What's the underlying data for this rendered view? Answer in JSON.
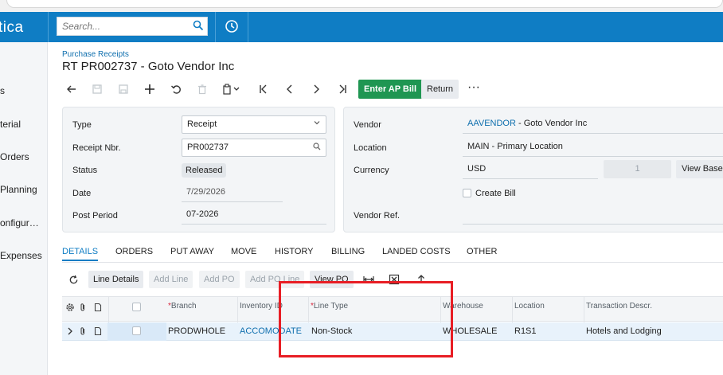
{
  "app": {
    "logo_text": "tica"
  },
  "search": {
    "placeholder": "Search..."
  },
  "sidebar": {
    "items": [
      {
        "label": "s"
      },
      {
        "label": "terial"
      },
      {
        "label": " Orders"
      },
      {
        "label": "Planning"
      },
      {
        "label": "onfigur…"
      },
      {
        "label": "Expenses"
      }
    ]
  },
  "page": {
    "breadcrumb": "Purchase Receipts",
    "title": "RT PR002737 - Goto Vendor Inc"
  },
  "toolbar": {
    "enter_ap_bill": "Enter AP Bill",
    "return": "Return",
    "more": "···"
  },
  "summary": {
    "type_label": "Type",
    "type_value": "Receipt",
    "receipt_nbr_label": "Receipt Nbr.",
    "receipt_nbr_value": "PR002737",
    "status_label": "Status",
    "status_value": "Released",
    "date_label": "Date",
    "date_value": "7/29/2026",
    "post_period_label": "Post Period",
    "post_period_value": "07-2026",
    "vendor_label": "Vendor",
    "vendor_code": "AAVENDOR",
    "vendor_name": " - Goto Vendor Inc",
    "location_label": "Location",
    "location_value": "MAIN - Primary Location",
    "currency_label": "Currency",
    "currency_value": "USD",
    "currency_rate": "1",
    "view_base": "View Base",
    "create_bill_label": "Create Bill",
    "vendor_ref_label": "Vendor Ref."
  },
  "tabs": [
    {
      "label": "DETAILS",
      "active": true
    },
    {
      "label": "ORDERS"
    },
    {
      "label": "PUT AWAY"
    },
    {
      "label": "MOVE"
    },
    {
      "label": "HISTORY"
    },
    {
      "label": "BILLING"
    },
    {
      "label": "LANDED COSTS"
    },
    {
      "label": "OTHER"
    }
  ],
  "grid_toolbar": {
    "line_details": "Line Details",
    "add_line": "Add Line",
    "add_po": "Add PO",
    "add_po_line": "Add PO Line",
    "view_po": "View PO"
  },
  "grid": {
    "columns": {
      "branch": "Branch",
      "inventory_id": "Inventory ID",
      "line_type": "Line Type",
      "warehouse": "Warehouse",
      "location": "Location",
      "transaction_descr": "Transaction Descr."
    },
    "rows": [
      {
        "branch": "PRODWHOLE",
        "inventory_id": "ACCOMODATE",
        "line_type": "Non-Stock",
        "warehouse": "WHOLESALE",
        "location": "R1S1",
        "transaction_descr": "Hotels and Lodging"
      }
    ]
  },
  "colors": {
    "brand": "#0f7dc4",
    "primary_action": "#1f9652",
    "highlight_box": "#e81e25",
    "link": "#0f6fae"
  }
}
